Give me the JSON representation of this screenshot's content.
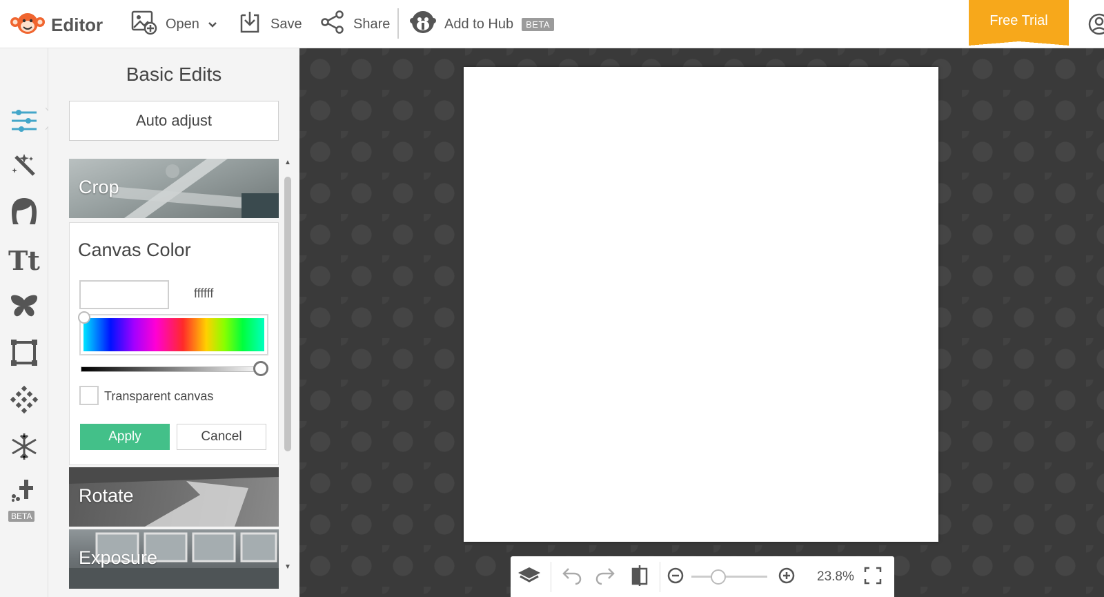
{
  "app": {
    "title": "Editor"
  },
  "toolbar": {
    "open_label": "Open",
    "save_label": "Save",
    "share_label": "Share",
    "hub_label": "Add to Hub",
    "hub_badge": "BETA",
    "free_trial_label": "Free Trial"
  },
  "rail": {
    "items": [
      "sliders-icon",
      "magic-wand-icon",
      "face-icon",
      "text-icon",
      "butterfly-icon",
      "frame-icon",
      "texture-icon",
      "snowflake-icon",
      "collage-icon"
    ],
    "beta_badge": "BETA"
  },
  "panel": {
    "title": "Basic Edits",
    "auto_adjust_label": "Auto adjust",
    "crop_label": "Crop",
    "rotate_label": "Rotate",
    "exposure_label": "Exposure",
    "canvas_color": {
      "title": "Canvas Color",
      "hex_value": "ffffff",
      "transparent_label": "Transparent canvas",
      "transparent_checked": false,
      "apply_label": "Apply",
      "cancel_label": "Cancel"
    }
  },
  "zoom": {
    "percent": "23.8%",
    "level": 0.238
  },
  "colors": {
    "accent": "#f7a81b",
    "apply": "#43c089",
    "workspace": "#3a3a3a",
    "icon": "#555555",
    "rail_active": "#43a6c9"
  }
}
